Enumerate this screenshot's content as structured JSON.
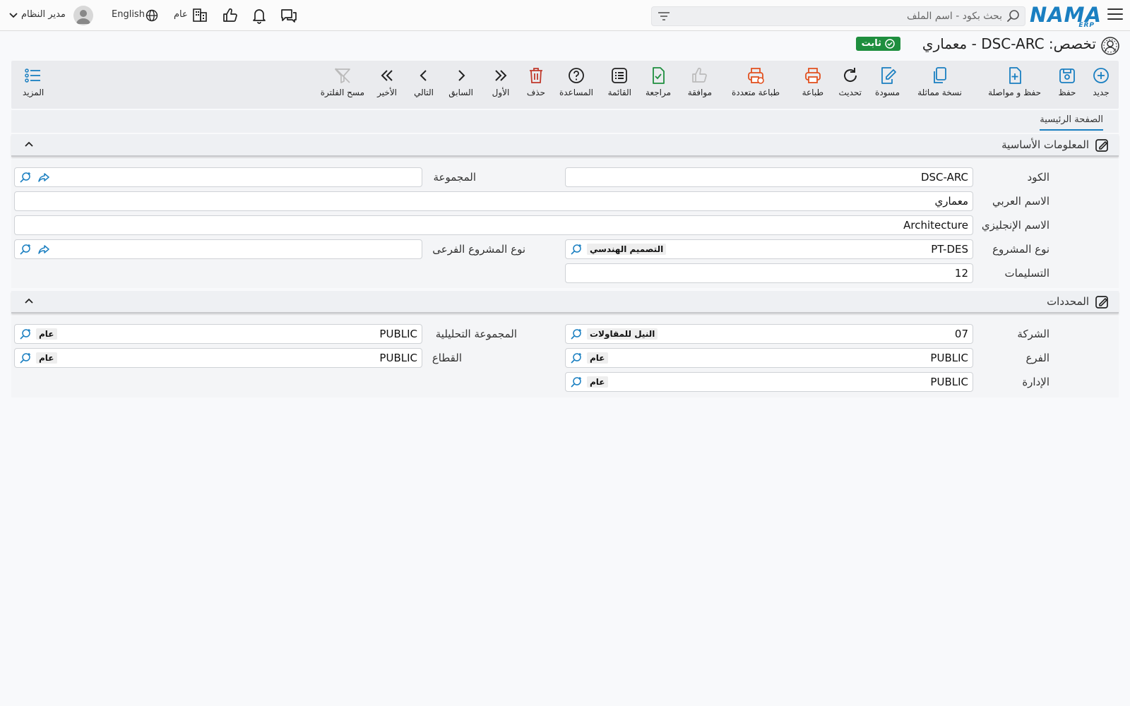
{
  "app": {
    "logo": "NAMA",
    "logo_sub": "ERP"
  },
  "search": {
    "placeholder": "بحث بكود - اسم الملف"
  },
  "topbar": {
    "branch": "عام",
    "language": "English",
    "user": "مدير النظام"
  },
  "page": {
    "title": "تخصص: DSC-ARC - معماري",
    "status_badge": "ثابت"
  },
  "toolbar": {
    "new": "جديد",
    "save": "حفظ",
    "save_continue": "حفظ و مواصلة",
    "duplicate": "نسخة مماثلة",
    "draft": "مسودة",
    "refresh": "تحديث",
    "print": "طباعة",
    "multi_print": "طباعة متعددة",
    "approve": "موافقة",
    "review": "مراجعة",
    "list": "القائمة",
    "help": "المساعدة",
    "delete": "حذف",
    "first": "الأول",
    "previous": "السابق",
    "next": "التالي",
    "last": "الأخير",
    "clear_filter": "مسح الفلترة",
    "more": "المزيد"
  },
  "tabs": {
    "main": "الصفحة الرئيسية"
  },
  "basic": {
    "title": "المعلومات الأساسية",
    "code_label": "الكود",
    "code_value": "DSC-ARC",
    "group_label": "المجموعة",
    "arabic_name_label": "الاسم العربي",
    "arabic_name_value": "معماري",
    "english_name_label": "الاسم الإنجليزي",
    "english_name_value": "Architecture",
    "project_type_label": "نوع المشروع",
    "project_type_code": "PT-DES",
    "project_type_name": "التصميم الهندسي",
    "sub_project_type_label": "نوع المشروع الفرعى",
    "deliverables_label": "التسليمات",
    "deliverables_value": "12"
  },
  "dimensions": {
    "title": "المحددات",
    "company_label": "الشركة",
    "company_code": "07",
    "company_name": "النيل للمقاولات",
    "analytic_group_label": "المجموعة التحليلية",
    "analytic_group_code": "PUBLIC",
    "analytic_group_name": "عام",
    "branch_label": "الفرع",
    "branch_code": "PUBLIC",
    "branch_name": "عام",
    "sector_label": "القطاع",
    "sector_code": "PUBLIC",
    "sector_name": "عام",
    "department_label": "الإدارة",
    "department_code": "PUBLIC",
    "department_name": "عام"
  },
  "colors": {
    "brand": "#1a7fc1",
    "status": "#1e8e3e",
    "danger": "#e2501f",
    "success": "#1e8e3e"
  }
}
